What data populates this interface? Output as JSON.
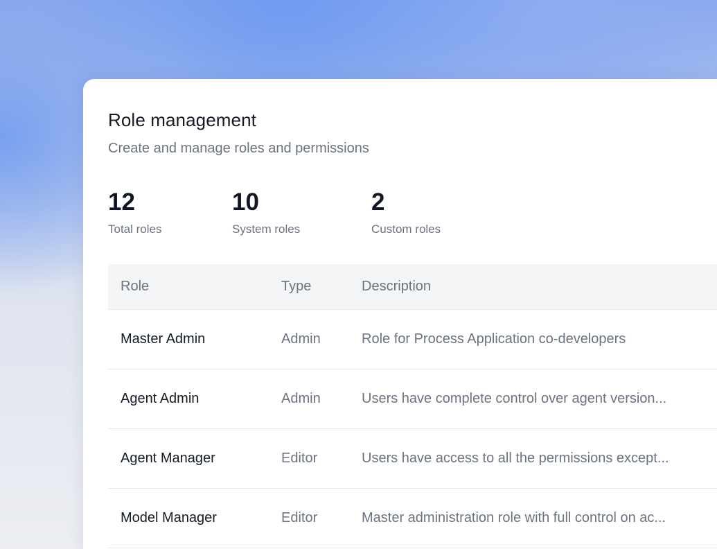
{
  "header": {
    "title": "Role management",
    "subtitle": "Create and manage roles and permissions"
  },
  "stats": [
    {
      "value": "12",
      "label": "Total roles"
    },
    {
      "value": "10",
      "label": "System roles"
    },
    {
      "value": "2",
      "label": "Custom roles"
    }
  ],
  "table": {
    "columns": [
      "Role",
      "Type",
      "Description"
    ],
    "rows": [
      {
        "role": "Master Admin",
        "type": "Admin",
        "description": "Role for Process Application co-developers"
      },
      {
        "role": "Agent Admin",
        "type": "Admin",
        "description": "Users have complete control over agent version..."
      },
      {
        "role": "Agent Manager",
        "type": "Editor",
        "description": "Users have access to all the permissions except..."
      },
      {
        "role": "Model Manager",
        "type": "Editor",
        "description": "Master administration role with full control on ac..."
      }
    ]
  }
}
